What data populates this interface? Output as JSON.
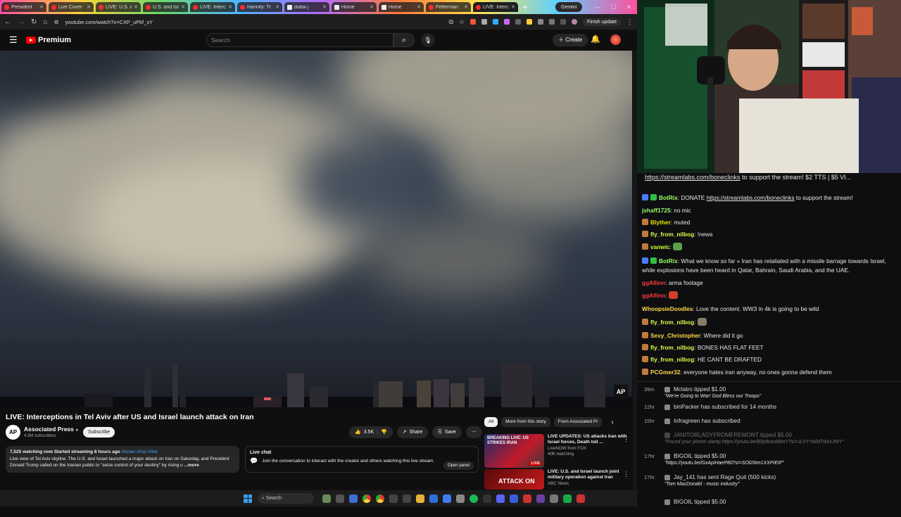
{
  "browser": {
    "tabs": [
      {
        "title": "President",
        "icon": "youtube"
      },
      {
        "title": "Live Cover",
        "icon": "youtube"
      },
      {
        "title": "LIVE: U.S. a",
        "icon": "youtube"
      },
      {
        "title": "U.S. and Isr",
        "icon": "youtube"
      },
      {
        "title": "LIVE: Interc",
        "icon": "youtube"
      },
      {
        "title": "Hannity: Tr",
        "icon": "youtube"
      },
      {
        "title": "dubai j",
        "icon": "x"
      },
      {
        "title": "Home",
        "icon": "x"
      },
      {
        "title": "Home",
        "icon": "x"
      },
      {
        "title": "Fetterman",
        "icon": "youtube"
      },
      {
        "title": "LIVE: Interc",
        "icon": "youtube",
        "active": true
      }
    ],
    "new_tab": "+",
    "gemini": "Gemini",
    "url": "youtube.com/watch?v=CXP_uPkf_sY",
    "finish_update": "Finish update"
  },
  "youtube": {
    "brand": "Premium",
    "search_placeholder": "Search",
    "create": "Create",
    "video": {
      "title": "LIVE: Interceptions in Tel Aviv after US and Israel launch attack on Iran",
      "watermark": "AP",
      "channel": "Associated Press",
      "channel_avatar": "AP",
      "subscribers": "4.3M subscribers",
      "subscribe": "Subscribe",
      "likes": "3.5K",
      "share": "Share",
      "save": "Save",
      "desc_meta": "7,525 watching now  Started streaming 8 hours ago",
      "desc_tags": "#Israel #Iran #live",
      "desc_text": "Live view of Tel Aviv skyline. The U.S. and Israel launched a major attack on Iran on Saturday, and President Donald Trump called on the Iranian public to \"seize control of your destiny\" by rising u",
      "desc_more": "...more"
    },
    "live_chat": {
      "heading": "Live chat",
      "text": "Join the conversation to interact with the creator and others watching this live stream.",
      "open_panel": "Open panel"
    },
    "chips": [
      "All",
      "More from this story",
      "From Associated Pr"
    ],
    "recommendations": [
      {
        "title": "LIVE UPDATES: US attacks Iran with Israel forces, Death toll ...",
        "channel": "LiveNOW from FOX",
        "meta": "40K watching",
        "thumb_text": "BREAKING LIVE: US STRIKES IRAN",
        "badge": "LIVE"
      },
      {
        "title": "LIVE: U.S. and Israel launch joint military operation against Iran",
        "channel": "ABC News",
        "meta": "",
        "thumb_text": "ATTACK ON"
      }
    ]
  },
  "taskbar": {
    "search": "Search"
  },
  "stream": {
    "pinned": {
      "link": "https://streamlabs.com/boneclinks",
      "rest": " to support the stream! $2 TTS | $5 VI..."
    },
    "messages": [
      {
        "user": "BotRix",
        "color": "#9bff6a",
        "text": "DONATE ",
        "link": "https://streamlabs.com/boneclinks",
        "after": " to support the stream!",
        "badges": [
          "#4a7bff",
          "#2fbf4a"
        ]
      },
      {
        "user": "jshaff1725",
        "color": "#9bff6a",
        "text": "no mic",
        "badges": []
      },
      {
        "user": "Blyther",
        "color": "#e6e600",
        "text": "muted",
        "badges": [
          "#c07a3a"
        ]
      },
      {
        "user": "fly_from_nilbog",
        "color": "#d9ff4a",
        "text": "!news",
        "badges": [
          "#c07a3a"
        ]
      },
      {
        "user": "vanwic",
        "color": "#c6ff2a",
        "text": "",
        "emote": "#5aa04a",
        "badges": [
          "#c07a3a"
        ]
      },
      {
        "user": "BotRix",
        "color": "#9bff6a",
        "text": "What we know so far » Iran has retaliated with a missile barrage towards Israel, while explosions have been heard in Qatar, Bahrain, Saudi Arabia, and the UAE.",
        "badges": [
          "#4a7bff",
          "#2fbf4a"
        ]
      },
      {
        "user": "ggAllinn",
        "color": "#ff3a3a",
        "text": "arma footage",
        "badges": []
      },
      {
        "user": "ggAllinn",
        "color": "#ff3a3a",
        "text": "",
        "emote": "#d0402a",
        "badges": []
      },
      {
        "user": "WhoopsieDoodles",
        "color": "#ffd84a",
        "text": "Love the content. WW3 in 4k is going to be wild",
        "badges": []
      },
      {
        "user": "fly_from_nilbog",
        "color": "#d9ff4a",
        "text": "",
        "emote": "#8a7a6a",
        "badges": [
          "#c07a3a"
        ]
      },
      {
        "user": "Sexy_Christopher",
        "color": "#ffd84a",
        "text": "Where did it go",
        "badges": [
          "#c07a3a"
        ]
      },
      {
        "user": "fly_from_nilbog",
        "color": "#d9ff4a",
        "text": "BONES HAS FLAT FEET",
        "badges": [
          "#c07a3a"
        ]
      },
      {
        "user": "fly_from_nilbog",
        "color": "#d9ff4a",
        "text": "HE CANT BE DRAFTED",
        "badges": [
          "#c07a3a"
        ]
      },
      {
        "user": "PCGmer32",
        "color": "#ffd84a",
        "text": "everyone hates iran anyway, no ones gonna defend them",
        "badges": [
          "#c07a3a"
        ]
      }
    ],
    "alerts": [
      {
        "time": "39m",
        "text": "Mclatro tipped $1.00",
        "sub": "\"We're Going to War! God Bless our Troops\""
      },
      {
        "time": "12hr",
        "text": "binPacker has subscribed for 14 months",
        "sub": ""
      },
      {
        "time": "15hr",
        "text": "Infragreen has subscribed",
        "sub": ""
      },
      {
        "time": "",
        "text": "JANITORLADYFROMFREMONT tipped $5.00",
        "sub": "\"Found your phone clamp https://youtu.be/fj0p9nzu6ktnY?si=JLVYYa0dTdXxJWY\"",
        "dim": true
      },
      {
        "time": "17hr",
        "text": "BIGOIL tipped $5.00",
        "sub": "\"https://youtu.be/GxApiHaeP80?si=SOl20im1XXPIEIF\""
      },
      {
        "time": "17hr",
        "text": "Jay_141 has sent Rage Quit (500 kicks)",
        "sub": "\"Tom MacDonald - music industry\""
      },
      {
        "time": "",
        "text": "BIGOIL tipped $5.00",
        "sub": ""
      }
    ]
  }
}
